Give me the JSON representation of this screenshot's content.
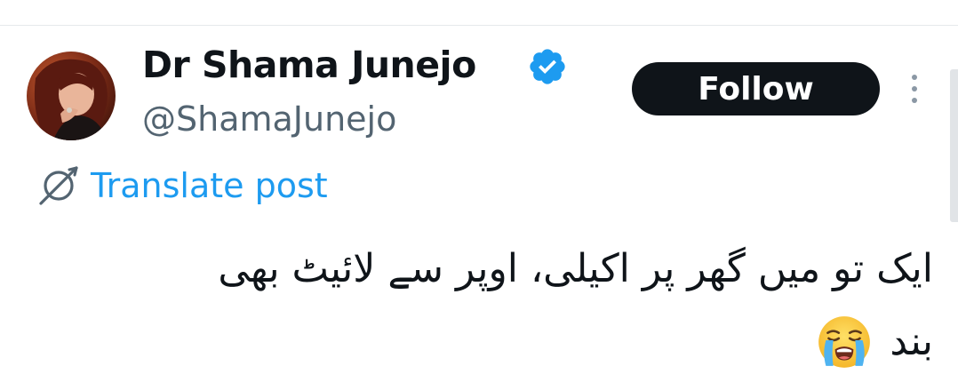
{
  "author": {
    "display_name": "Dr Shama Junejo",
    "handle": "@ShamaJunejo",
    "verified": true,
    "verified_color": "#1d9bf0"
  },
  "actions": {
    "follow_label": "Follow",
    "more_icon": "more-vertical-icon"
  },
  "translate": {
    "label": "Translate post",
    "icon": "translate-icon",
    "color": "#1d9bf0"
  },
  "post": {
    "line1": "ایک تو میں گھر پر اکیلی، اوپر سے لائیٹ بھی",
    "line2": "بند",
    "emoji": "😭"
  },
  "colors": {
    "text": "#0f1419",
    "secondary": "#536471",
    "button_bg": "#0f1419",
    "button_text": "#ffffff"
  }
}
